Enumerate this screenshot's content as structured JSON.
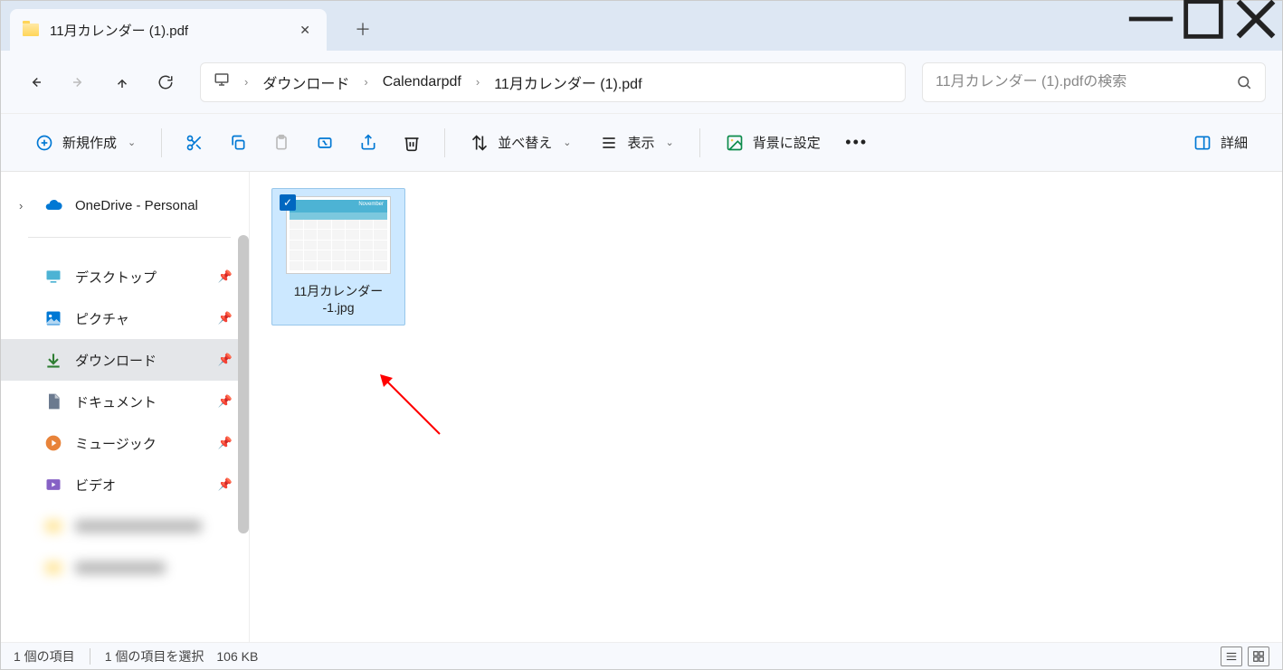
{
  "tab": {
    "title": "11月カレンダー (1).pdf"
  },
  "breadcrumb": {
    "p1": "ダウンロード",
    "p2": "Calendarpdf",
    "p3": "11月カレンダー (1).pdf"
  },
  "search": {
    "placeholder": "11月カレンダー (1).pdfの検索"
  },
  "toolbar": {
    "new": "新規作成",
    "sort": "並べ替え",
    "view": "表示",
    "background": "背景に設定",
    "details": "詳細"
  },
  "sidebar": {
    "onedrive": "OneDrive - Personal",
    "items": [
      {
        "label": "デスクトップ"
      },
      {
        "label": "ピクチャ"
      },
      {
        "label": "ダウンロード"
      },
      {
        "label": "ドキュメント"
      },
      {
        "label": "ミュージック"
      },
      {
        "label": "ビデオ"
      }
    ]
  },
  "file": {
    "name_line1": "11月カレンダー",
    "name_line2": "-1.jpg",
    "thumb_header": "November"
  },
  "status": {
    "count": "1 個の項目",
    "selection": "1 個の項目を選択",
    "size": "106 KB"
  }
}
